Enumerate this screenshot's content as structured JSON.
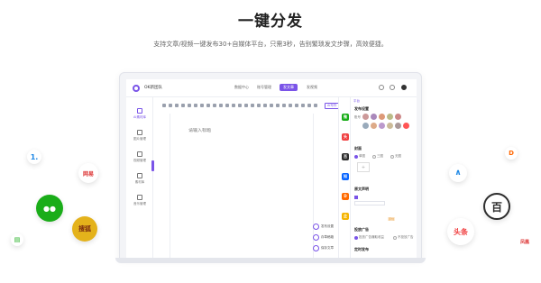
{
  "hero": {
    "title": "一键分发",
    "subtitle": "支持文章/视频一键发布30+自媒体平台，只需3秒，告别繁琐发文步骤，高效便捷。"
  },
  "app": {
    "team_label": "OK新团队",
    "nav": [
      "数据中心",
      "账号管理",
      "发文章",
      "发视频"
    ],
    "active_nav": "发文章",
    "sidebar": [
      {
        "label": "AI素材库",
        "icon": "t-icon"
      },
      {
        "label": "图片管理",
        "icon": "image-icon"
      },
      {
        "label": "视频管理",
        "icon": "video-icon"
      },
      {
        "label": "素材库",
        "icon": "library-icon"
      },
      {
        "label": "音乐管理",
        "icon": "music-icon"
      }
    ],
    "editor": {
      "title_placeholder": "请输入标题",
      "toolbar_button": "AI写作",
      "side_actions": [
        "发布设置",
        "存草稿箱",
        "保存文章"
      ]
    },
    "accounts": [
      {
        "label": "微",
        "color": "#1aad19"
      },
      {
        "label": "头",
        "color": "#f04142"
      },
      {
        "label": "百",
        "color": "#2d2d2d"
      },
      {
        "label": "知",
        "color": "#0a66ff"
      },
      {
        "label": "D",
        "color": "#ff6b00"
      },
      {
        "label": "企",
        "color": "#f5b400"
      }
    ],
    "right_panel": {
      "tag": "平台",
      "publish_settings": "发布设置",
      "account_label": "账号",
      "cover_label": "封面",
      "cover_options": [
        "单图",
        "三图",
        "无图"
      ],
      "original": "原文声明",
      "ad": "投放广告",
      "ad_options": [
        "投放广告赚取收益",
        "不投放广告"
      ],
      "schedule": "定时发布",
      "tag_text": "原创"
    }
  },
  "platforms": [
    {
      "name": "ifeng-logo",
      "label": "1.",
      "color": "#1e88e5"
    },
    {
      "name": "netease-logo",
      "label": "网易",
      "color": "#d33"
    },
    {
      "name": "wechat-logo",
      "label": "●●",
      "color": "#1aad19"
    },
    {
      "name": "sohu-logo",
      "label": "搜狐",
      "color": "#e4b21b"
    },
    {
      "name": "green-tab-logo",
      "label": "▤",
      "color": "#1aad19"
    },
    {
      "name": "douyin-logo",
      "label": "D",
      "color": "#f60"
    },
    {
      "name": "bilibili-logo",
      "label": "∧",
      "color": "#1e88e5"
    },
    {
      "name": "baijiahao-logo",
      "label": "百",
      "color": "#2d2d2d"
    },
    {
      "name": "toutiao-logo",
      "label": "头条",
      "color": "#f04142"
    },
    {
      "name": "fenghuang-logo",
      "label": "凤凰",
      "color": "#d33"
    }
  ]
}
